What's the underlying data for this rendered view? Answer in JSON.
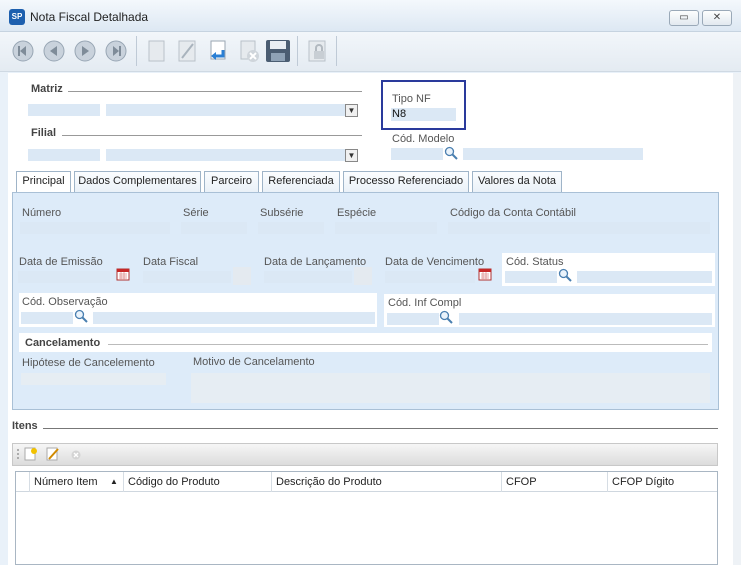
{
  "window": {
    "title": "Nota Fiscal Detalhada",
    "app_icon_text": "SP",
    "minimize_glyph": "▭",
    "close_glyph": "✕"
  },
  "toolbar": {
    "buttons": [
      "first-record-icon",
      "previous-record-icon",
      "next-record-icon",
      "last-record-icon",
      "new-document-icon",
      "edit-icon",
      "undo-icon",
      "delete-icon",
      "save-icon",
      "lock-icon"
    ]
  },
  "header": {
    "matriz_label": "Matriz",
    "filial_label": "Filial",
    "tipo_nf_label": "Tipo NF",
    "tipo_nf_value": "N8",
    "cod_modelo_label": "Cód. Modelo",
    "combo_arrow": "▼"
  },
  "tabs": [
    {
      "label": "Principal",
      "active": true
    },
    {
      "label": "Dados Complementares",
      "active": false
    },
    {
      "label": "Parceiro",
      "active": false
    },
    {
      "label": "Referenciada",
      "active": false
    },
    {
      "label": "Processo Referenciado",
      "active": false
    },
    {
      "label": "Valores da Nota",
      "active": false
    }
  ],
  "principal": {
    "numero_label": "Número",
    "serie_label": "Série",
    "subserie_label": "Subsérie",
    "especie_label": "Espécie",
    "conta_contabil_label": "Código da Conta Contábil",
    "data_emissao_label": "Data de Emissão",
    "data_fiscal_label": "Data Fiscal",
    "data_lancamento_label": "Data de Lançamento",
    "data_vencimento_label": "Data de Vencimento",
    "cod_status_label": "Cód. Status",
    "cod_observacao_label": "Cód. Observação",
    "cod_inf_compl_label": "Cód. Inf Compl",
    "cancelamento_label": "Cancelamento",
    "hipotese_cancelamento_label": "Hipótese de Cancelemento",
    "motivo_cancelamento_label": "Motivo de Cancelamento"
  },
  "itens": {
    "section_label": "Itens",
    "columns": [
      "Número Item",
      "Código do Produto",
      "Descrição do Produto",
      "CFOP",
      "CFOP Dígito"
    ],
    "sort_indicator": "▲",
    "rows": []
  },
  "colors": {
    "accent_border": "#2a3a9c",
    "field_fill": "#dbe8f5",
    "panel_fill": "#ddebf9"
  }
}
